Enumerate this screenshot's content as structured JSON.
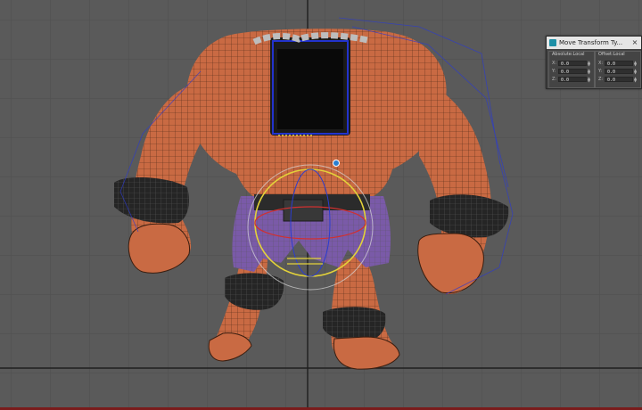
{
  "dialog": {
    "title": "Move Transform Ty...",
    "close_glyph": "×",
    "groups": [
      {
        "title": "Absolute:Local",
        "rows": [
          {
            "label": "X:",
            "value": "0.0"
          },
          {
            "label": "Y:",
            "value": "0.0"
          },
          {
            "label": "Z:",
            "value": "0.0"
          }
        ]
      },
      {
        "title": "Offset:Local",
        "rows": [
          {
            "label": "X:",
            "value": "0.0"
          },
          {
            "label": "Y:",
            "value": "0.0"
          },
          {
            "label": "Z:",
            "value": "0.0"
          }
        ]
      }
    ]
  },
  "viewport": {
    "icons": {
      "app": "3dsmax-icon",
      "close": "close-icon"
    },
    "colors": {
      "background": "#5a5a5a",
      "grid": "#4e4e4e",
      "axis": "#1e1e1e",
      "skin": "#c96a43",
      "wire": "#3a1e10",
      "shorts": "#7a5aa8",
      "cuff": "#252525",
      "selection": "#2233cc",
      "gizmo_yellow": "#e3d23a",
      "gizmo_red": "#d03030"
    }
  }
}
